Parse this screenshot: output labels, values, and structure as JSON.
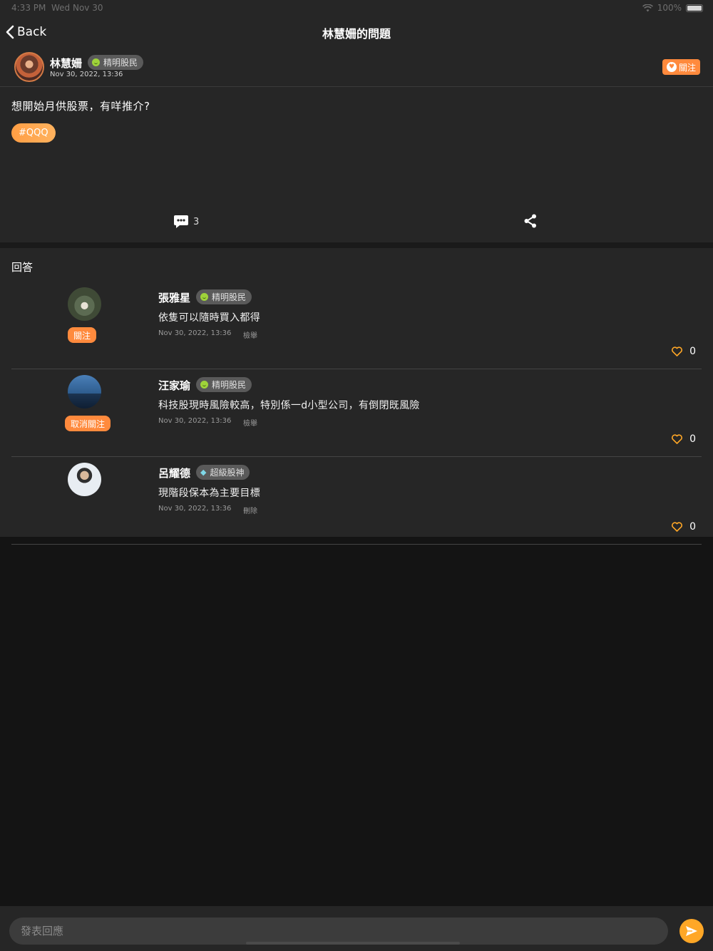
{
  "status_bar": {
    "time": "4:33 PM",
    "date": "Wed Nov 30",
    "battery": "100%",
    "wifi_icon": "wifi-icon"
  },
  "nav": {
    "back_label": "Back",
    "title": "林慧姍的問題"
  },
  "question": {
    "author": "林慧姍",
    "badge": "精明股民",
    "time": "Nov 30, 2022, 13:36",
    "follow_label": "關注",
    "text": "想開始月供股票，有咩推介?",
    "tag": "#QQQ",
    "comment_count": "3"
  },
  "answers_heading": "回答",
  "answers": [
    {
      "name": "張雅星",
      "badge": "精明股民",
      "badge_icon": "smiley-icon",
      "text": "依隻可以隨時買入都得",
      "time": "Nov 30, 2022, 13:36",
      "action": "檢舉",
      "follow_label": "關注",
      "likes": "0"
    },
    {
      "name": "汪家瑜",
      "badge": "精明股民",
      "badge_icon": "smiley-icon",
      "text": "科技股現時風險較高，特別係一d小型公司，有倒閉既風險",
      "time": "Nov 30, 2022, 13:36",
      "action": "檢舉",
      "follow_label": "取消關注",
      "likes": "0"
    },
    {
      "name": "呂耀德",
      "badge": "超級股神",
      "badge_icon": "diamond-icon",
      "text": "現階段保本為主要目標",
      "time": "Nov 30, 2022, 13:36",
      "action": "刪除",
      "follow_label": "",
      "likes": "0"
    }
  ],
  "reply": {
    "placeholder": "發表回應"
  },
  "colors": {
    "accent": "#ff8a3d",
    "background": "#141414",
    "card": "#262626",
    "badge": "#5a5a5a"
  }
}
